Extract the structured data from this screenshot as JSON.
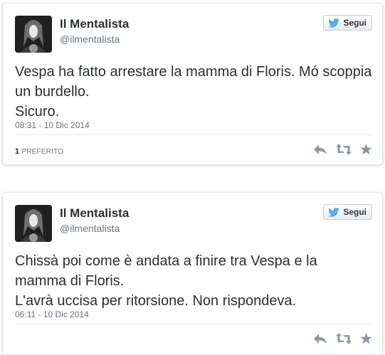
{
  "tweets": [
    {
      "display_name": "Il Mentalista",
      "handle": "@ilmentalista",
      "follow_label": "Segui",
      "text": "Vespa ha fatto arrestare la mamma di Floris. Mó scoppia un burdello.\nSicuro.",
      "timestamp": "08:31 - 10 Dic 2014",
      "favorites_count": "1",
      "favorites_label": "PREFERITO",
      "icons": [
        "reply-icon",
        "retweet-icon",
        "favorite-icon"
      ]
    },
    {
      "display_name": "Il Mentalista",
      "handle": "@ilmentalista",
      "follow_label": "Segui",
      "text": "Chissà poi come è andata a finire tra Vespa e la mamma di Floris.\nL'avrà uccisa per ritorsione. Non rispondeva.",
      "timestamp": "06:11 - 10 Dic 2014",
      "icons": [
        "reply-icon",
        "retweet-icon",
        "favorite-icon"
      ]
    }
  ],
  "colors": {
    "twitter_blue": "#55acee",
    "text": "#292f33",
    "muted": "#66757f",
    "icon_gray": "#8899a6"
  }
}
